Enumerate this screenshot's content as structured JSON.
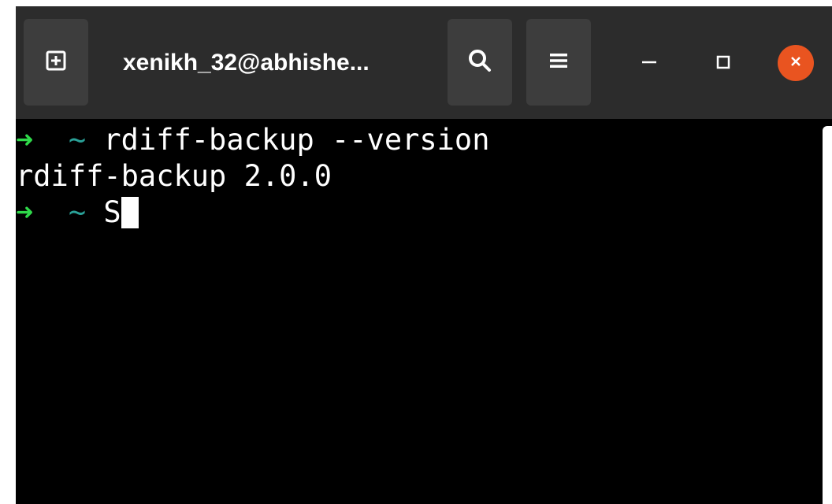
{
  "window": {
    "title": "xenikh_32@abhishe..."
  },
  "titlebar": {
    "new_tab_icon": "new-tab-icon",
    "search_icon": "search-icon",
    "menu_icon": "hamburger-menu-icon",
    "minimize_icon": "minimize-icon",
    "maximize_icon": "maximize-icon",
    "close_icon": "close-icon",
    "close_color": "#e95420"
  },
  "terminal": {
    "lines": [
      {
        "prompt_arrow": "➜",
        "prompt_dir": "~",
        "command": "rdiff-backup --version"
      },
      {
        "output": "rdiff-backup 2.0.0"
      },
      {
        "prompt_arrow": "➜",
        "prompt_dir": "~",
        "input": "S"
      }
    ],
    "colors": {
      "background": "#000000",
      "text": "#ffffff",
      "arrow": "#2fd94a",
      "dir": "#2aa198"
    }
  }
}
